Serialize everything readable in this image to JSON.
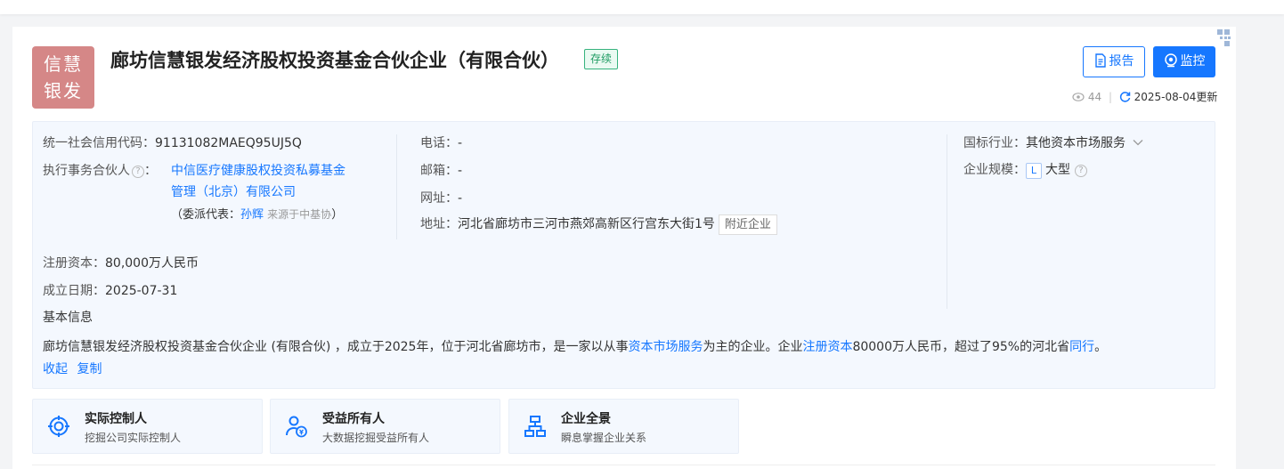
{
  "company": {
    "logo_line1": "信慧",
    "logo_line2": "银发",
    "name": "廊坊信慧银发经济股权投资基金合伙企业（有限合伙）",
    "status": "存续"
  },
  "actions": {
    "report_label": "报告",
    "monitor_label": "监控"
  },
  "meta": {
    "views": "44",
    "separator": "|",
    "updated": "2025-08-04更新"
  },
  "details": {
    "credit_code_label": "统一社会信用代码：",
    "credit_code": "91131082MAEQ95UJ5Q",
    "partner_label": "执行事务合伙人",
    "partner_colon": "：",
    "partner_line1": "中信医疗健康股权投资私募基金",
    "partner_line2": "管理（北京）有限公司",
    "delegate_prefix": "（委派代表：",
    "delegate_name": "孙辉",
    "delegate_source": "来源于中基协",
    "delegate_suffix": "）",
    "phone_label": "电话：",
    "phone": "-",
    "email_label": "邮箱：",
    "email": "-",
    "website_label": "网址：",
    "website": "-",
    "address_label": "地址：",
    "address": "河北省廊坊市三河市燕郊高新区行宫东大街1号",
    "nearby_label": "附近企业",
    "industry_label": "国标行业：",
    "industry": "其他资本市场服务",
    "scale_label": "企业规模：",
    "scale_badge": "L",
    "scale": "大型",
    "capital_label": "注册资本：",
    "capital": "80,000万人民币",
    "founded_label": "成立日期：",
    "founded": "2025-07-31",
    "basic_info_label": "基本信息"
  },
  "summary": {
    "part1": "廊坊信慧银发经济股权投资基金合伙企业 (有限合伙) ，成立于2025年，位于河北省廊坊市，是一家以从事",
    "link1": "资本市场服务",
    "part2": "为主的企业。企业",
    "link2": "注册资本",
    "part3": "80000万人民币，超过了95%的河北省",
    "link3": "同行",
    "part4": "。",
    "collapse": "收起",
    "copy": "复制"
  },
  "tiles": [
    {
      "title": "实际控制人",
      "desc": "挖掘公司实际控制人"
    },
    {
      "title": "受益所有人",
      "desc": "大数据挖掘受益所有人"
    },
    {
      "title": "企业全景",
      "desc": "瞬息掌握企业关系"
    }
  ],
  "colors": {
    "accent": "#1677ff",
    "logo_bg": "#d58787",
    "status_green": "#1e9b62"
  },
  "icons": {
    "report": "document-icon",
    "monitor": "monitor-eye-icon",
    "views": "eye-icon",
    "refresh": "refresh-icon",
    "dropdown": "chevron-down-icon",
    "help": "question-circle-icon",
    "qr": "qr-code-icon",
    "tile1": "target-icon",
    "tile2": "person-coin-icon",
    "tile3": "org-chart-icon"
  }
}
